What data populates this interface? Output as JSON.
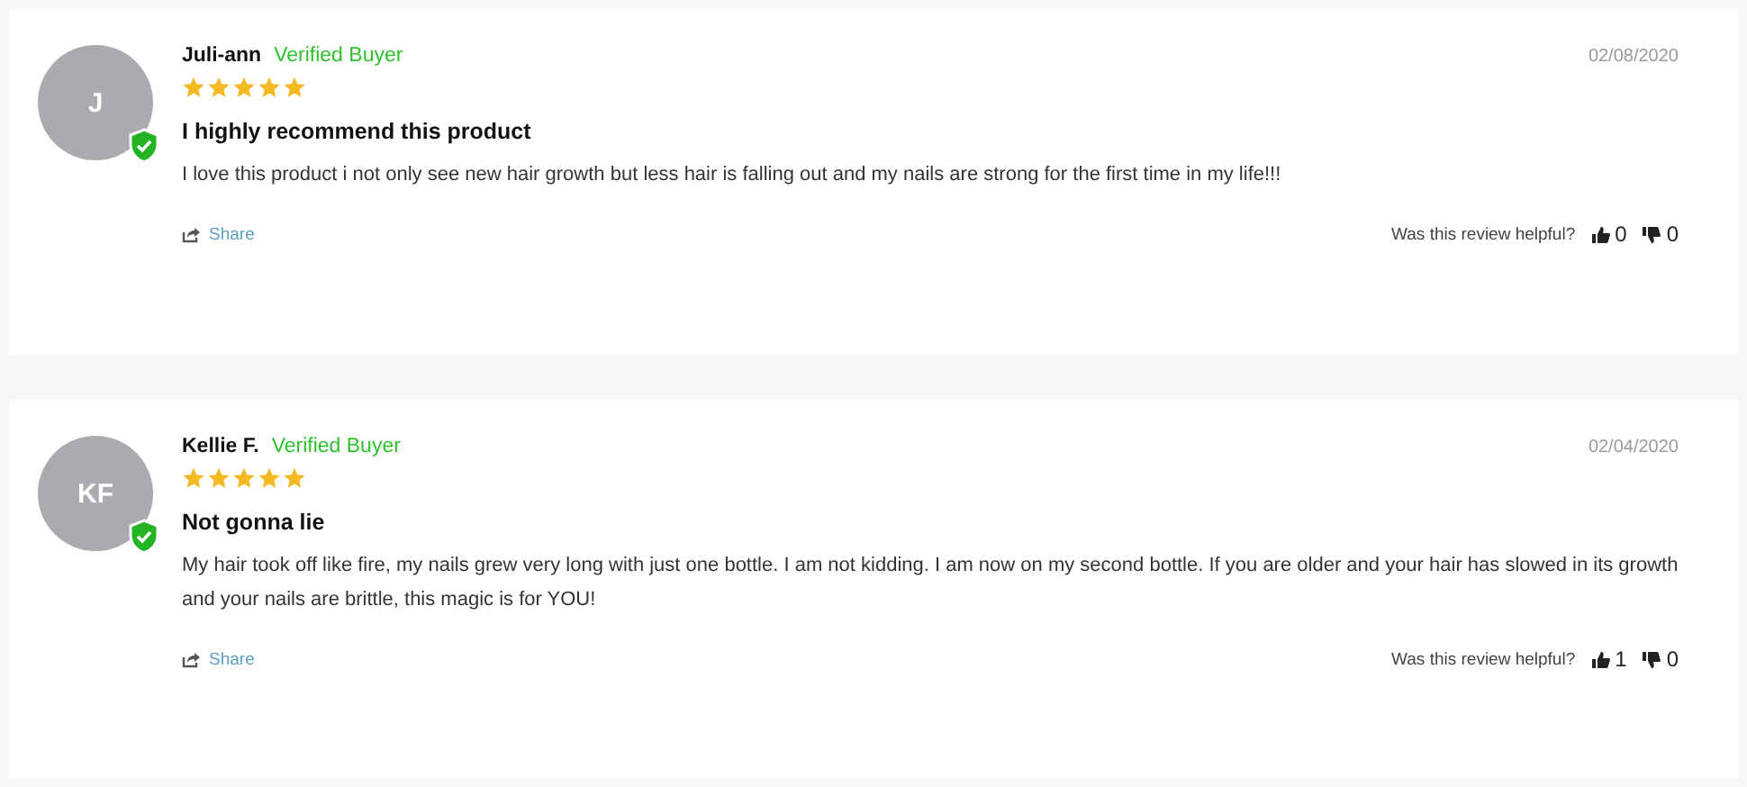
{
  "reviews": [
    {
      "initials": "J",
      "verified": true,
      "name": "Juli-ann",
      "badge": "Verified Buyer",
      "date": "02/08/2020",
      "stars": 5,
      "title": "I highly recommend this product",
      "body": "I love this product i not only see new hair growth but less hair is falling out and my nails are strong for the first time in my life!!!",
      "share": "Share",
      "helpful_label": "Was this review helpful?",
      "up_count": "0",
      "down_count": "0"
    },
    {
      "initials": "KF",
      "verified": true,
      "name": "Kellie F.",
      "badge": "Verified Buyer",
      "date": "02/04/2020",
      "stars": 5,
      "title": "Not gonna lie",
      "body": "My hair took off like fire, my nails grew very long with just one bottle. I am not kidding. I am now on my second bottle. If you are older and your hair has slowed in its growth and your nails are brittle, this magic is for YOU!",
      "share": "Share",
      "helpful_label": "Was this review helpful?",
      "up_count": "1",
      "down_count": "0"
    }
  ]
}
